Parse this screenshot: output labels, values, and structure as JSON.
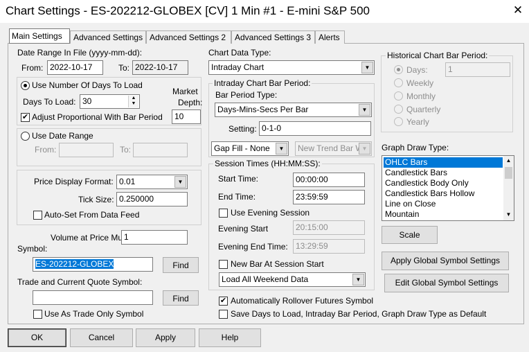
{
  "window": {
    "title": "Chart Settings - ES-202212-GLOBEX [CV]  1 Min   #1 - E-mini S&P 500",
    "close": "✕"
  },
  "tabs": [
    "Main Settings",
    "Advanced Settings",
    "Advanced Settings 2",
    "Advanced Settings 3",
    "Alerts"
  ],
  "date_range": {
    "label": "Date Range In File (yyyy-mm-dd):",
    "from_label": "From:",
    "from": "2022-10-17",
    "to_label": "To:",
    "to": "2022-10-17"
  },
  "days": {
    "radio_label": "Use Number Of Days To Load",
    "days_label": "Days To Load:",
    "days_value": "30",
    "market_depth_label1": "Market",
    "market_depth_label2": "Depth:",
    "market_depth": "10",
    "adjust_label": "Adjust Proportional With Bar Period"
  },
  "date_range_opt": {
    "radio_label": "Use Date Range",
    "from_label": "From:",
    "to_label": "To:"
  },
  "price": {
    "format_label": "Price Display Format:",
    "format_value": "0.01",
    "tick_label": "Tick Size:",
    "tick_value": "0.250000",
    "autoset_label": "Auto-Set From Data Feed"
  },
  "volume": {
    "label": "Volume at Price Mult.:",
    "value": "1"
  },
  "symbol": {
    "label": "Symbol:",
    "value": "ES-202212-GLOBEX",
    "find": "Find",
    "trade_label": "Trade and Current Quote Symbol:",
    "trade_value": "",
    "find2": "Find",
    "trade_only_label": "Use As Trade Only Symbol"
  },
  "chart_type": {
    "label": "Chart Data Type:",
    "value": "Intraday Chart"
  },
  "intraday": {
    "legend": "Intraday Chart Bar Period:",
    "bar_period_type_label": "Bar Period Type:",
    "bar_period_type": "Days-Mins-Secs Per Bar",
    "setting_label": "Setting:",
    "setting": "0-1-0",
    "gap_fill": "Gap Fill - None",
    "new_trend": "New Trend Bar W"
  },
  "session": {
    "legend": "Session Times (HH:MM:SS):",
    "start_label": "Start Time:",
    "start": "00:00:00",
    "end_label": "End Time:",
    "end": "23:59:59",
    "evening_label": "Use Evening Session",
    "evening_start_label": "Evening Start",
    "evening_start": "20:15:00",
    "evening_end_label": "Evening End Time:",
    "evening_end": "13:29:59",
    "new_bar_label": "New Bar At Session Start",
    "weekend": "Load All Weekend Data"
  },
  "rollover_label": "Automatically Rollover Futures Symbol",
  "save_default_label": "Save Days to Load, Intraday Bar Period, Graph Draw Type as Default",
  "historical": {
    "legend": "Historical Chart Bar Period:",
    "options": [
      "Days:",
      "Weekly",
      "Monthly",
      "Quarterly",
      "Yearly"
    ],
    "days_value": "1"
  },
  "graph": {
    "label": "Graph Draw Type:",
    "items": [
      "OHLC Bars",
      "Candlestick Bars",
      "Candlestick Body Only",
      "Candlestick Bars Hollow",
      "Line on Close",
      "Mountain"
    ]
  },
  "buttons": {
    "scale": "Scale",
    "apply_global": "Apply Global Symbol Settings",
    "edit_global": "Edit Global Symbol Settings",
    "ok": "OK",
    "cancel": "Cancel",
    "apply": "Apply",
    "help": "Help"
  }
}
